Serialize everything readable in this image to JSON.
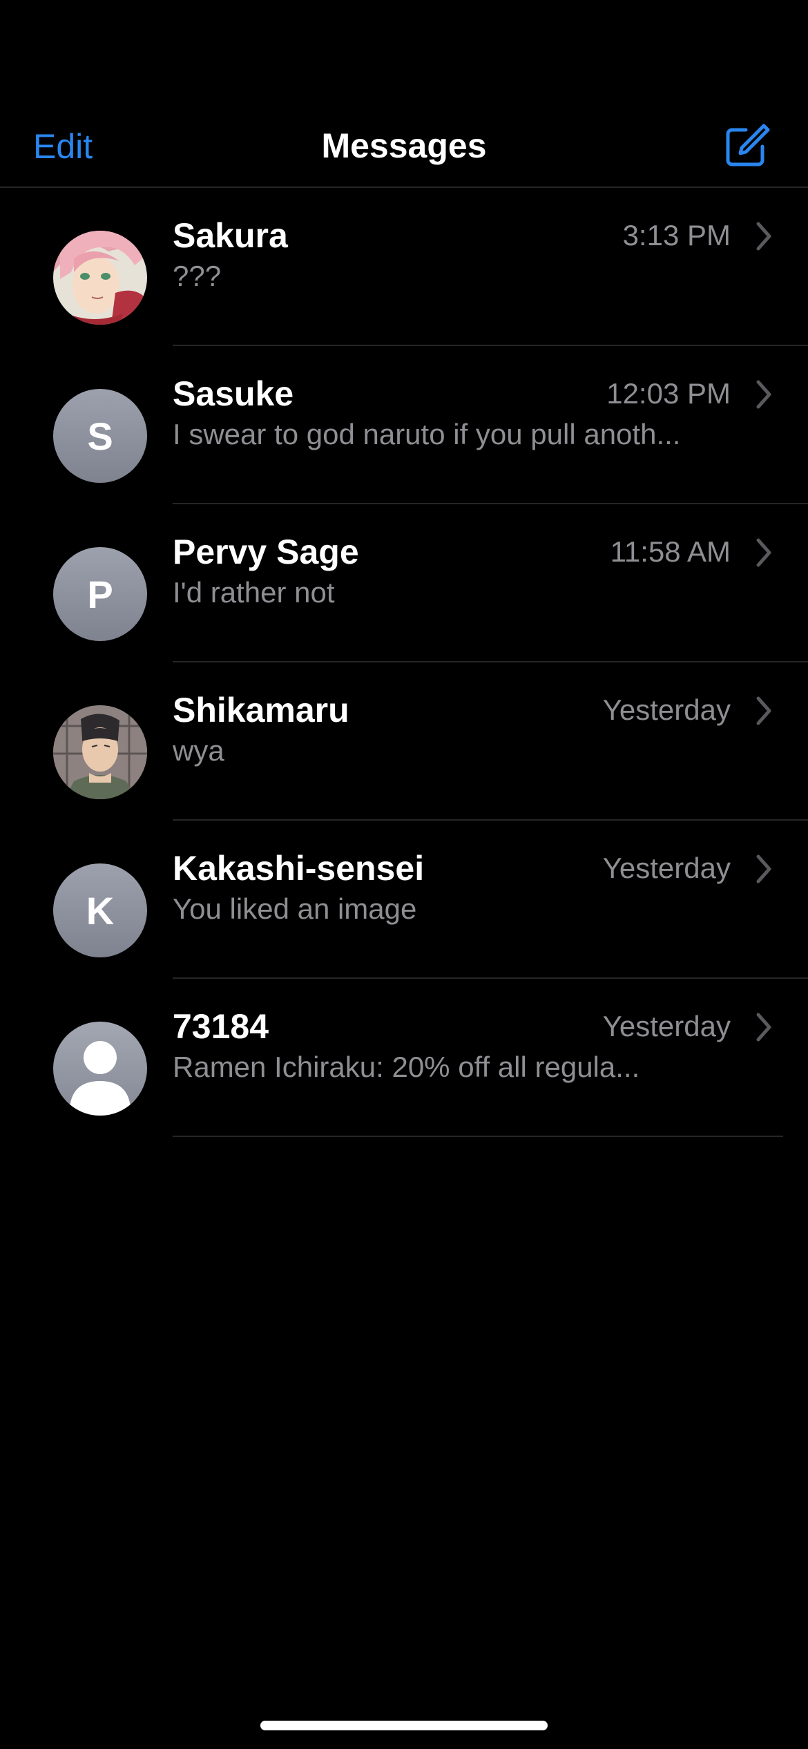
{
  "nav": {
    "edit_label": "Edit",
    "title": "Messages",
    "compose_icon": "compose-icon"
  },
  "colors": {
    "accent": "#2a86ef",
    "secondary_text": "#8e8e93",
    "separator": "#262628",
    "background": "#000000"
  },
  "conversations": [
    {
      "name": "Sakura",
      "time": "3:13 PM",
      "preview": "???",
      "avatar": "photo-sakura"
    },
    {
      "name": "Sasuke",
      "time": "12:03 PM",
      "preview": "I swear to god naruto if you pull anoth...",
      "avatar_initial": "S"
    },
    {
      "name": "Pervy Sage",
      "time": "11:58 AM",
      "preview": "I'd rather not",
      "avatar_initial": "P"
    },
    {
      "name": "Shikamaru",
      "time": "Yesterday",
      "preview": "wya",
      "avatar": "photo-shikamaru"
    },
    {
      "name": "Kakashi-sensei",
      "time": "Yesterday",
      "preview": "You liked an image",
      "avatar_initial": "K"
    },
    {
      "name": "73184",
      "time": "Yesterday",
      "preview": "Ramen Ichiraku: 20% off all regula...",
      "avatar": "person-silhouette-icon"
    }
  ]
}
